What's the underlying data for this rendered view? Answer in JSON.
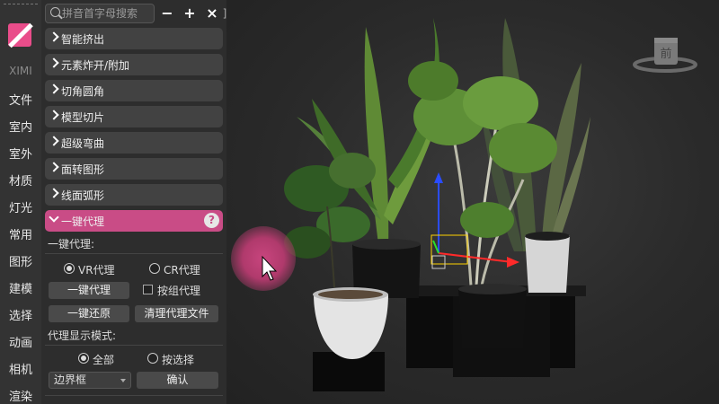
{
  "sidebar": {
    "brand": "XIMI",
    "items": [
      "文件",
      "室内",
      "室外",
      "材质",
      "灯光",
      "常用",
      "图形",
      "建模",
      "选择",
      "动画",
      "相机",
      "渲染"
    ]
  },
  "panel": {
    "search": {
      "placeholder": "拼音首字母搜索",
      "value": ""
    },
    "toolbar": {
      "minus": "−",
      "plus": "+",
      "close": "×",
      "bracket": "]"
    },
    "accordion": [
      "智能挤出",
      "元素炸开/附加",
      "切角圆角",
      "模型切片",
      "超级弯曲",
      "面转图形",
      "线面弧形"
    ],
    "active_section": {
      "label": "一键代理",
      "help": "?"
    },
    "section_heading": "一键代理:",
    "radio_vr": "VR代理",
    "radio_cr": "CR代理",
    "btn_proxy": "一键代理",
    "chk_group": "按组代理",
    "btn_restore": "一键还原",
    "btn_clean": "清理代理文件",
    "display_mode_label": "代理显示模式:",
    "radio_all": "全部",
    "radio_select": "按选择",
    "dropdown_value": "边界框",
    "btn_confirm": "确认"
  },
  "viewcube": {
    "label": "前"
  },
  "colors": {
    "accent": "#c94c86",
    "logo": "#e94d8a"
  }
}
